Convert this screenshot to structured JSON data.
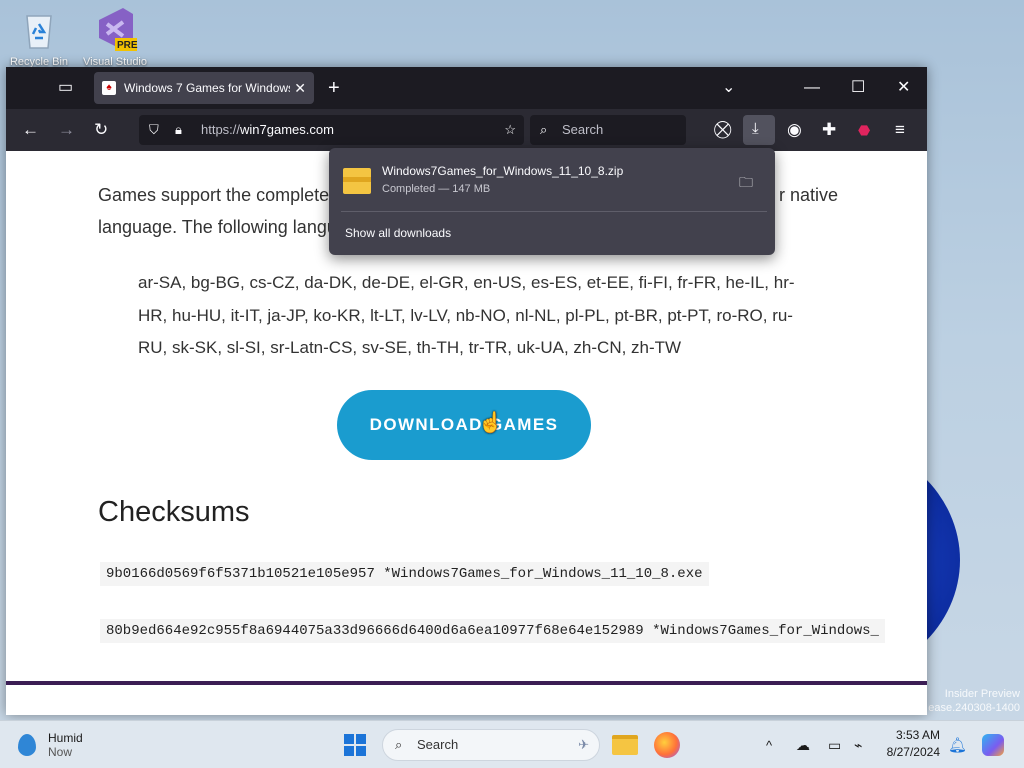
{
  "desktop": {
    "icons": [
      {
        "label": "Recycle Bin"
      },
      {
        "label": "Visual Studio",
        "badge": "PRE"
      }
    ],
    "watermark": [
      "Insider Preview",
      "ease.240308-1400"
    ]
  },
  "browser": {
    "tab": {
      "title": "Windows 7 Games for Windows"
    },
    "url": {
      "prefix": "https://",
      "host": "win7games.com"
    },
    "search_placeholder": "Search"
  },
  "download_panel": {
    "filename": "Windows7Games_for_Windows_11_10_8.zip",
    "status": "Completed — 147 MB",
    "show_all": "Show all downloads"
  },
  "page": {
    "intro": "Games support the complete language. The following langu native",
    "intro_left_line1": "Games support the complete",
    "intro_right_line1": "r native",
    "intro_line2": "language. The following langu",
    "languages": "ar-SA, bg-BG, cs-CZ, da-DK, de-DE, el-GR, en-US, es-ES, et-EE, fi-FI, fr-FR, he-IL, hr-HR, hu-HU, it-IT, ja-JP, ko-KR, lt-LT, lv-LV, nb-NO, nl-NL, pl-PL, pt-BR, pt-PT, ro-RO, ru-RU, sk-SK, sl-SI, sr-Latn-CS, sv-SE, th-TH, tr-TR, uk-UA, zh-CN, zh-TW",
    "download_button": "DOWNLOAD GAMES",
    "checksums_heading": "Checksums",
    "checksum_1": "9b0166d0569f6f5371b10521e105e957 *Windows7Games_for_Windows_11_10_8.exe",
    "checksum_2": "80b9ed664e92c955f8a6944075a33d96666d6400d6a6ea10977f68e64e152989 *Windows7Games_for_Windows_"
  },
  "taskbar": {
    "weather": {
      "title": "Humid",
      "sub": "Now"
    },
    "search_placeholder": "Search",
    "time": "3:53 AM",
    "date": "8/27/2024"
  },
  "colors": {
    "download_button": "#1a9ccf",
    "toolbar": "#2b2a33",
    "tabstrip": "#1c1b22"
  }
}
